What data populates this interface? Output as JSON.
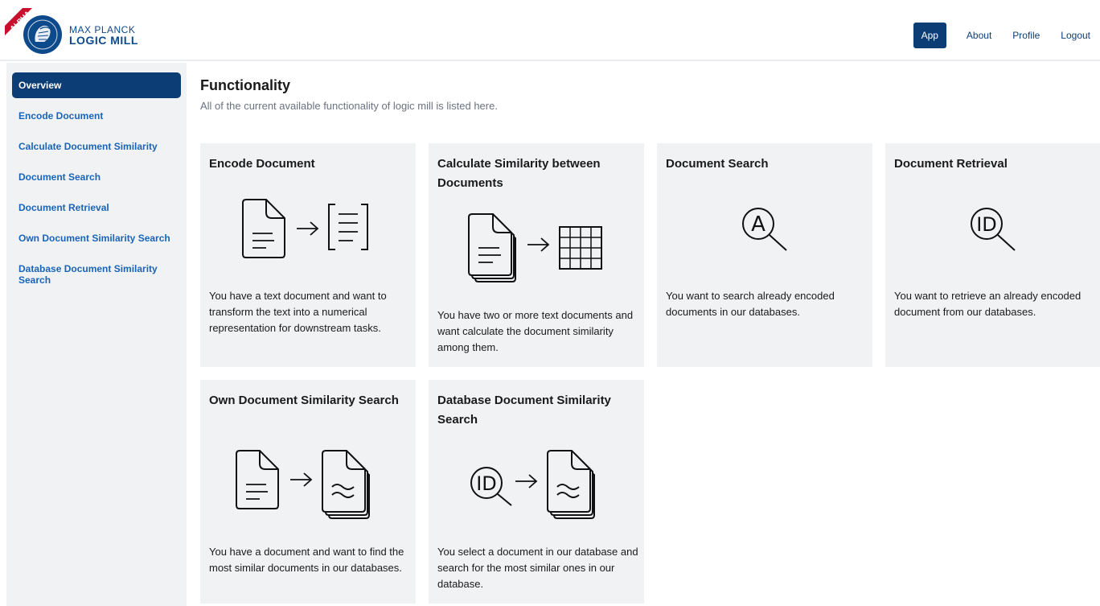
{
  "header": {
    "badge": "ALPHA",
    "logo_line1": "MAX PLANCK",
    "logo_line2": "LOGIC MILL",
    "nav": [
      {
        "label": "App",
        "active": true
      },
      {
        "label": "About",
        "active": false
      },
      {
        "label": "Profile",
        "active": false
      },
      {
        "label": "Logout",
        "active": false
      }
    ]
  },
  "sidebar": {
    "items": [
      {
        "label": "Overview",
        "active": true
      },
      {
        "label": "Encode Document"
      },
      {
        "label": "Calculate Document Similarity"
      },
      {
        "label": "Document Search"
      },
      {
        "label": "Document Retrieval"
      },
      {
        "label": "Own Document Similarity Search"
      },
      {
        "label": "Database Document Similarity Search"
      }
    ]
  },
  "main": {
    "title": "Functionality",
    "subtitle": "All of the current available functionality of logic mill is listed here.",
    "cards": [
      {
        "title": "Encode Document",
        "icon": "document-to-list-icon",
        "description": "You have a text document and want to transform the text into a numerical representation for downstream tasks."
      },
      {
        "title": "Calculate Similarity between Documents",
        "icon": "documents-to-grid-icon",
        "description": "You have two or more text documents and want calculate the document similarity among them."
      },
      {
        "title": "Document Search",
        "icon": "search-a-icon",
        "description": "You want to search already encoded documents in our databases."
      },
      {
        "title": "Document Retrieval",
        "icon": "search-id-icon",
        "description": "You want to retrieve an already encoded document from our databases."
      },
      {
        "title": "Own Document Similarity Search",
        "icon": "document-to-similar-icon",
        "description": "You have a document and want to find the most similar documents in our databases."
      },
      {
        "title": "Database Document Similarity Search",
        "icon": "id-to-similar-icon",
        "description": "You select a document in our database and search for the most similar ones in our database."
      }
    ]
  },
  "colors": {
    "navy": "#0d3d75",
    "link_blue": "#1a64b8",
    "card_bg": "#f1f2f4",
    "badge_red": "#c8102e"
  }
}
